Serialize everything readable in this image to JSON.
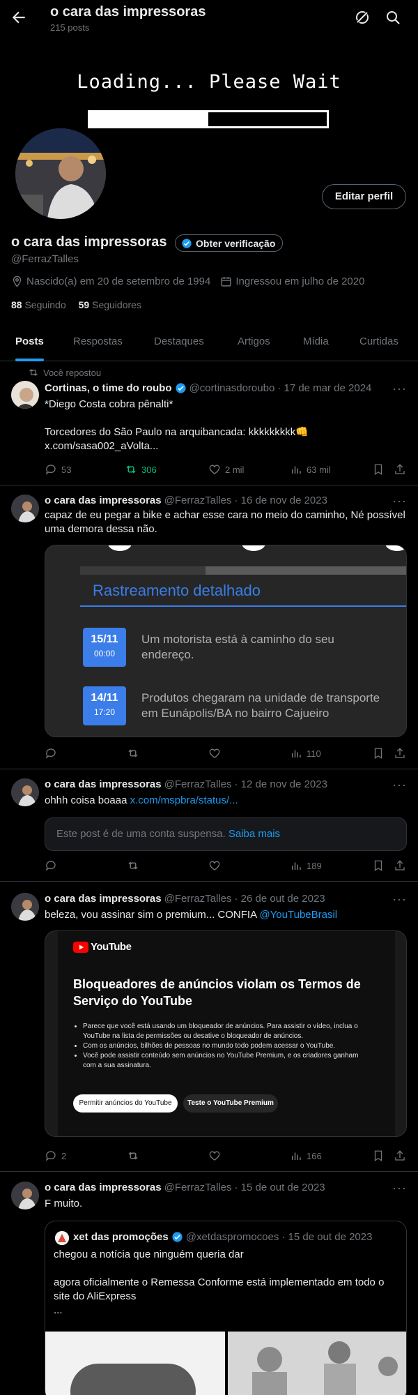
{
  "header": {
    "title": "o cara das impressoras",
    "posts_count": "215 posts"
  },
  "banner": {
    "text": "Loading... Please Wait",
    "progress": 0.5
  },
  "profile": {
    "name": "o cara das impressoras",
    "verify_label": "Obter verificação",
    "handle": "@FerrazTalles",
    "birth": "Nascido(a) em 20 de setembro de 1994",
    "joined": "Ingressou em julho de 2020",
    "following_count": "88",
    "following_label": "Seguindo",
    "followers_count": "59",
    "followers_label": "Seguidores",
    "edit_label": "Editar perfil"
  },
  "tabs": [
    "Posts",
    "Respostas",
    "Destaques",
    "Artigos",
    "Mídia",
    "Curtidas"
  ],
  "posts": [
    {
      "repost_label": "Você repostou",
      "name": "Cortinas, o time do roubo",
      "handle": "@cortinasdoroubo",
      "date": "· 17 de mar de 2024",
      "text": "*Diego Costa cobra pênalti*\n\nTorcedores do São Paulo na arquibancada: kkkkkkkkk👊",
      "link": "x.com/sasa002_aVolta...",
      "replies": "53",
      "reposts": "306",
      "likes": "2 mil",
      "views": "63 mil"
    },
    {
      "name": "o cara das impressoras",
      "handle": "@FerrazTalles",
      "date": "· 16 de nov de 2023",
      "text": "capaz de eu pegar a bike e achar esse cara no meio do caminho, Né possível uma demora dessa não.",
      "media": {
        "title": "Rastreamento detalhado",
        "events": [
          {
            "date": "15/11",
            "time": "00:00",
            "text": "Um motorista está à caminho do seu endereço."
          },
          {
            "date": "14/11",
            "time": "17:20",
            "text": "Produtos chegaram na unidade de transporte em Eunápolis/BA no bairro Cajueiro"
          }
        ]
      },
      "views": "110"
    },
    {
      "name": "o cara das impressoras",
      "handle": "@FerrazTalles",
      "date": "· 12 de nov de 2023",
      "text": "ohhh coisa boaaa",
      "link": "x.com/mspbra/status/...",
      "suspended_text": "Este post é de uma conta suspensa.",
      "suspended_link": "Saiba mais",
      "views": "189"
    },
    {
      "name": "o cara das impressoras",
      "handle": "@FerrazTalles",
      "date": "· 26 de out de 2023",
      "text": "beleza, vou assinar sim o premium... CONFIA",
      "mention": "@YouTubeBrasil",
      "media": {
        "logo": "YouTube",
        "title": "Bloqueadores de anúncios violam os Termos de Serviço do YouTube",
        "bullets": [
          "Parece que você está usando um bloqueador de anúncios. Para assistir o vídeo, inclua o YouTube na lista de permissões ou desative o bloqueador de anúncios.",
          "Com os anúncios, bilhões de pessoas no mundo todo podem acessar o YouTube.",
          "Você pode assistir conteúdo sem anúncios no YouTube Premium, e os criadores ganham com a sua assinatura."
        ],
        "btn_allow": "Permitir anúncios do YouTube",
        "btn_premium": "Teste o YouTube Premium"
      },
      "replies": "2",
      "views": "166"
    },
    {
      "name": "o cara das impressoras",
      "handle": "@FerrazTalles",
      "date": "· 15 de out de 2023",
      "text": "F muito.",
      "quote": {
        "name": "xet das promoções",
        "handle": "@xetdaspromocoes",
        "date": "· 15 de out de 2023",
        "text": "chegou a notícia que ninguém queria dar\n\nagora oficialmente o Remessa Conforme está implementado em todo o site do AliExpress\n..."
      }
    }
  ],
  "colors": {
    "accent": "#1d9bf0",
    "repost_green": "#00ba7c",
    "tracking_blue": "#3b7de9"
  }
}
